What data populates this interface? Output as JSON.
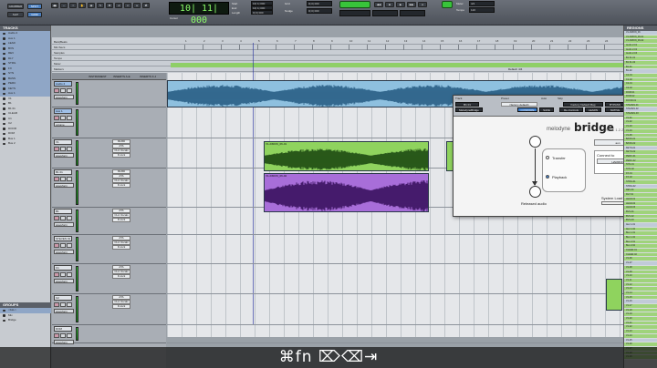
{
  "transport": {
    "buttons": [
      "GRABBER",
      "SPOT",
      "SLIP",
      "GRID"
    ],
    "counter": "10| 11| 000",
    "start_label": "Start",
    "end_label": "End",
    "length_label": "Length",
    "start_value": "10| 1| 000",
    "end_value": "10| 1| 000",
    "length_value": "0| 0| 000",
    "cursor_label": "Cursor",
    "nudge_label": "Nudge",
    "grid_label": "Grid",
    "pre_roll": "0| 0| 000",
    "meter_label": "Meter",
    "tempo_label": "Tempo",
    "meter_value": "4/4",
    "tempo_value": "120"
  },
  "tracks_panel": {
    "title": "TRACKS",
    "items": [
      "Audio 2",
      "Aux 1",
      "LEAD",
      "BVS",
      "REV",
      "DLY",
      "STRG",
      "FX",
      "SYN",
      "BASS",
      "PERC",
      "KEYS",
      "Aux 1",
      "V1",
      "B1",
      "B1 01",
      "CLEAR",
      "C1",
      "C2",
      "DOOR",
      "DOM",
      "Bus 1",
      "Bus 2"
    ],
    "selected": [
      0,
      1,
      2,
      3,
      4,
      5,
      6,
      7,
      8,
      9,
      10,
      11,
      12
    ]
  },
  "groups_panel": {
    "title": "GROUPS",
    "items": [
      "<ALL>",
      "Mix",
      "Bridge"
    ]
  },
  "ruler_labels": [
    "Bars|Beats",
    "Min:Secs",
    "Samples",
    "Tempo",
    "Meter",
    "Markers"
  ],
  "bar_numbers": [
    "1",
    "2",
    "3",
    "4",
    "5",
    "6",
    "7",
    "8",
    "9",
    "10",
    "11",
    "12",
    "13",
    "14",
    "15",
    "16",
    "17",
    "18",
    "19",
    "20",
    "21",
    "22",
    "23",
    "24",
    "25"
  ],
  "markers_label": "Default: 4/4",
  "mixer_headers": {
    "instrument": "INSTRUMENT",
    "inserts_ae": "INSERTS A-E",
    "inserts_fj": "INSERTS F-J"
  },
  "track_rows": [
    {
      "name": "Audio 2",
      "view": "waveform",
      "highlight": true
    },
    {
      "name": "Aux 1",
      "view": "volume",
      "highlight": true
    },
    {
      "name": "V1",
      "view": "waveform",
      "highlight": false,
      "inserts": [
        "MLBD",
        "ATA",
        "CLA Vocals",
        "D-lock"
      ]
    },
    {
      "name": "B1 01",
      "view": "waveform",
      "highlight": false,
      "inserts": [
        "MLBD",
        "ATA",
        "CLA Vocals",
        "D-lock"
      ]
    },
    {
      "name": "B1",
      "view": "waveform",
      "highlight": false,
      "inserts": [
        "ATA",
        "CLA Vocals",
        "D-lock"
      ]
    },
    {
      "name": "STEVEN 01",
      "view": "waveform",
      "highlight": false,
      "inserts": [
        "ATA",
        "CLA Vocals",
        "D-lock"
      ]
    },
    {
      "name": "C1",
      "view": "waveform",
      "highlight": false,
      "inserts": [
        "ATA",
        "CLA Vocals",
        "D-lock"
      ]
    },
    {
      "name": "C2",
      "view": "waveform",
      "highlight": false,
      "inserts": [
        "ATA",
        "CLA Vocals",
        "D-lock"
      ]
    },
    {
      "name": "DOM",
      "view": "waveform",
      "highlight": false
    }
  ],
  "clips": [
    {
      "name": "Audio 2",
      "color": "#8ec0df"
    },
    {
      "name": "V1-DMON_06-01",
      "color": "#8fd35e"
    },
    {
      "name": "V1-DMON_06-02",
      "color": "#a86ed9"
    }
  ],
  "plugin": {
    "track_label": "Track",
    "preset_label": "Preset",
    "auto_label": "Auto",
    "skip_label": "Skip",
    "track_name": "B1 01",
    "insert_name": "MelodyneBridge",
    "preset_value": "<factory default>",
    "compare": "COMPARE",
    "safe": "SAFE",
    "factory_default": "Factory Default Map",
    "bypass": "BYPASS",
    "native": "NATIVE",
    "learn": "LEARN",
    "controls": "Re-Controls",
    "brand": "melodyne",
    "product": "bridge",
    "version": "RTAS 1.2.2.2",
    "transfer": "Transfer",
    "playback": "Playback",
    "released_audio": "Released audio",
    "dropdown_value": "aun",
    "connect_to_label": "Connect to",
    "connect_to_value": "HARMONY",
    "system_load_label": "System Load"
  },
  "regions_panel": {
    "title": "REGIONS",
    "items": [
      "V1-DMON_06",
      "V1-DMON_06-01",
      "V1-DMON_06-02",
      "Audio 2-01",
      "Audio 2-02",
      "Audio 2-03",
      "B1 01-01",
      "B1 01-02",
      "B1-01",
      "B1-02",
      "C1-01",
      "C1-02",
      "C2-01",
      "C2-02",
      "DOM-01",
      "DOM-02",
      "DOOR-01",
      "STEVEN-01",
      "STEVEN-02",
      "STEVEN-03",
      "V1-01",
      "V1-02",
      "V1-03",
      "V1-04",
      "V1-05",
      "BASS-01",
      "BASS-02",
      "KEYS-01",
      "KEYS-02",
      "PERC-01",
      "PERC-02",
      "SYN-01",
      "SYN-02",
      "FX-01",
      "FX-02",
      "STRG-01",
      "STRG-02",
      "REV-01",
      "DLY-01",
      "LEAD-01",
      "LEAD-02",
      "LEAD-03",
      "BVS-01",
      "BVS-02",
      "BVS-03",
      "Aux 1-01",
      "Aux 1-02",
      "Bus 1-01",
      "Bus 1-02",
      "Bus 2-01",
      "Bus 2-02",
      "CLEAR-01",
      "CLEAR-02",
      "V1-06",
      "V1-07",
      "V1-08",
      "V1-09",
      "V1-10",
      "V1-11",
      "V1-12",
      "V1-13",
      "V1-14",
      "V1-15",
      "V1-16",
      "V1-17",
      "V1-18",
      "V1-19",
      "V1-20",
      "V1-21",
      "V1-22",
      "V1-23",
      "V1-24",
      "V1-25",
      "V1-26",
      "V1-27",
      "V1-28",
      "V1-29"
    ]
  },
  "keyboard_overlay": "⌘fn ⌦⌫⇥"
}
